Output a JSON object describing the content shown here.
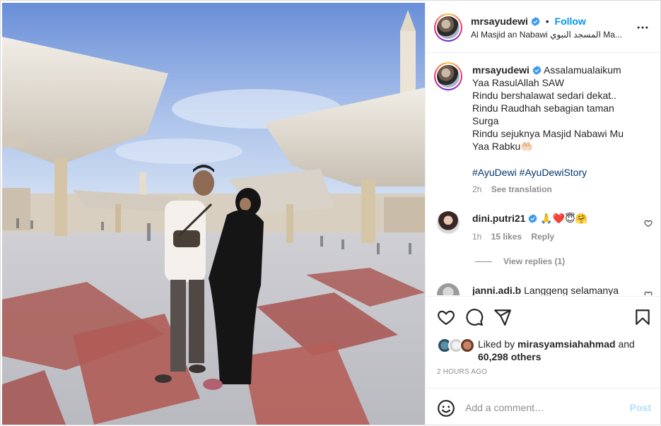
{
  "post": {
    "username": "mrsayudewi",
    "follow_label": "Follow",
    "separator": "•",
    "location": "Al Masjid an Nabawi المسجد النبوي Ma..."
  },
  "caption": {
    "username": "mrsayudewi",
    "lines": [
      "Assalamualaikum",
      "Yaa RasulAllah SAW",
      "Rindu bershalawat sedari dekat..",
      "Rindu Raudhah sebagian taman",
      "Surga",
      "Rindu sejuknya Masjid Nabawi Mu",
      "Yaa Rabku🤲🏻"
    ],
    "hashtags": "#AyuDewi #AyuDewiStory",
    "time": "2h",
    "see_translation": "See translation"
  },
  "comments": [
    {
      "username": "dini.putri21",
      "text": "🙏❤️😇🤗",
      "time": "1h",
      "likes": "15 likes",
      "reply_label": "Reply"
    },
    {
      "username": "janni.adi.b",
      "text": "Langgeng selamanya"
    }
  ],
  "view_replies": "View replies (1)",
  "likes": {
    "prefix": "Liked by",
    "user": "mirasyamsiahahmad",
    "and": "and",
    "others": "60,298 others"
  },
  "time_ago": "2 HOURS AGO",
  "add_comment": {
    "placeholder": "Add a comment…",
    "post_label": "Post"
  },
  "icons": {
    "more": "more-horizontal-icon",
    "like": "heart-icon",
    "comment": "comment-icon",
    "share": "share-icon",
    "save": "bookmark-icon",
    "emoji": "emoji-icon",
    "verified": "verified-badge-icon"
  },
  "colors": {
    "link_blue": "#0095f6",
    "hashtag": "#00376b",
    "post_disabled": "#b2dffc",
    "muted": "#8e8e8e",
    "verified": "#3897f0"
  }
}
